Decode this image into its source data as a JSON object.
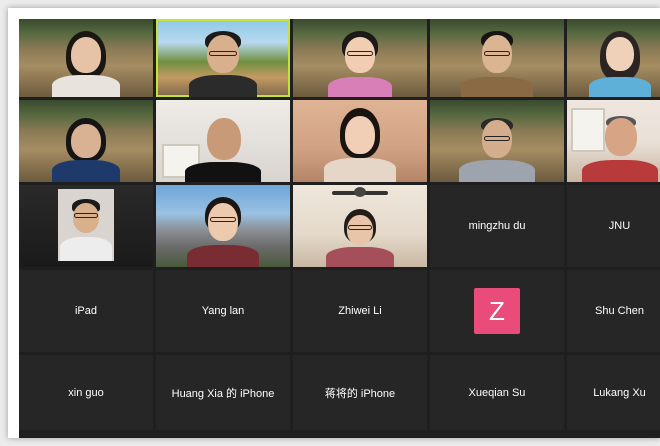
{
  "app": {
    "view": "gallery"
  },
  "participants": [
    {
      "name": "",
      "video": true,
      "bg": "school"
    },
    {
      "name": "",
      "video": true,
      "bg": "campus",
      "active_speaker": true
    },
    {
      "name": "",
      "video": true,
      "bg": "school"
    },
    {
      "name": "",
      "video": true,
      "bg": "school"
    },
    {
      "name": "",
      "video": true,
      "bg": "school"
    },
    {
      "name": "",
      "video": true,
      "bg": "school"
    },
    {
      "name": "",
      "video": true,
      "bg": "room"
    },
    {
      "name": "",
      "video": true,
      "bg": "warm"
    },
    {
      "name": "",
      "video": true,
      "bg": "school"
    },
    {
      "name": "",
      "video": true,
      "bg": "window"
    },
    {
      "name": "",
      "video": true,
      "bg": "dark"
    },
    {
      "name": "",
      "video": true,
      "bg": "building"
    },
    {
      "name": "",
      "video": true,
      "bg": "ceiling"
    },
    {
      "name": "mingzhu du",
      "video": false
    },
    {
      "name": "JNU",
      "video": false
    },
    {
      "name": "iPad",
      "video": false
    },
    {
      "name": "Yang lan",
      "video": false
    },
    {
      "name": "Zhiwei Li",
      "video": false
    },
    {
      "name": "",
      "video": false,
      "avatar_letter": "Z",
      "avatar_color": "#e94b7b"
    },
    {
      "name": "Shu Chen",
      "video": false
    },
    {
      "name": "xin guo",
      "video": false
    },
    {
      "name": "Huang Xia 的 iPhone",
      "video": false
    },
    {
      "name": "蒋将的 iPhone",
      "video": false
    },
    {
      "name": "Xueqian Su",
      "video": false
    },
    {
      "name": "Lukang Xu",
      "video": false
    }
  ],
  "colors": {
    "grid_bg": "#1f1f1f",
    "tile_bg": "#262626",
    "active_border": "#c6e23a",
    "avatar_z": "#e94b7b"
  }
}
